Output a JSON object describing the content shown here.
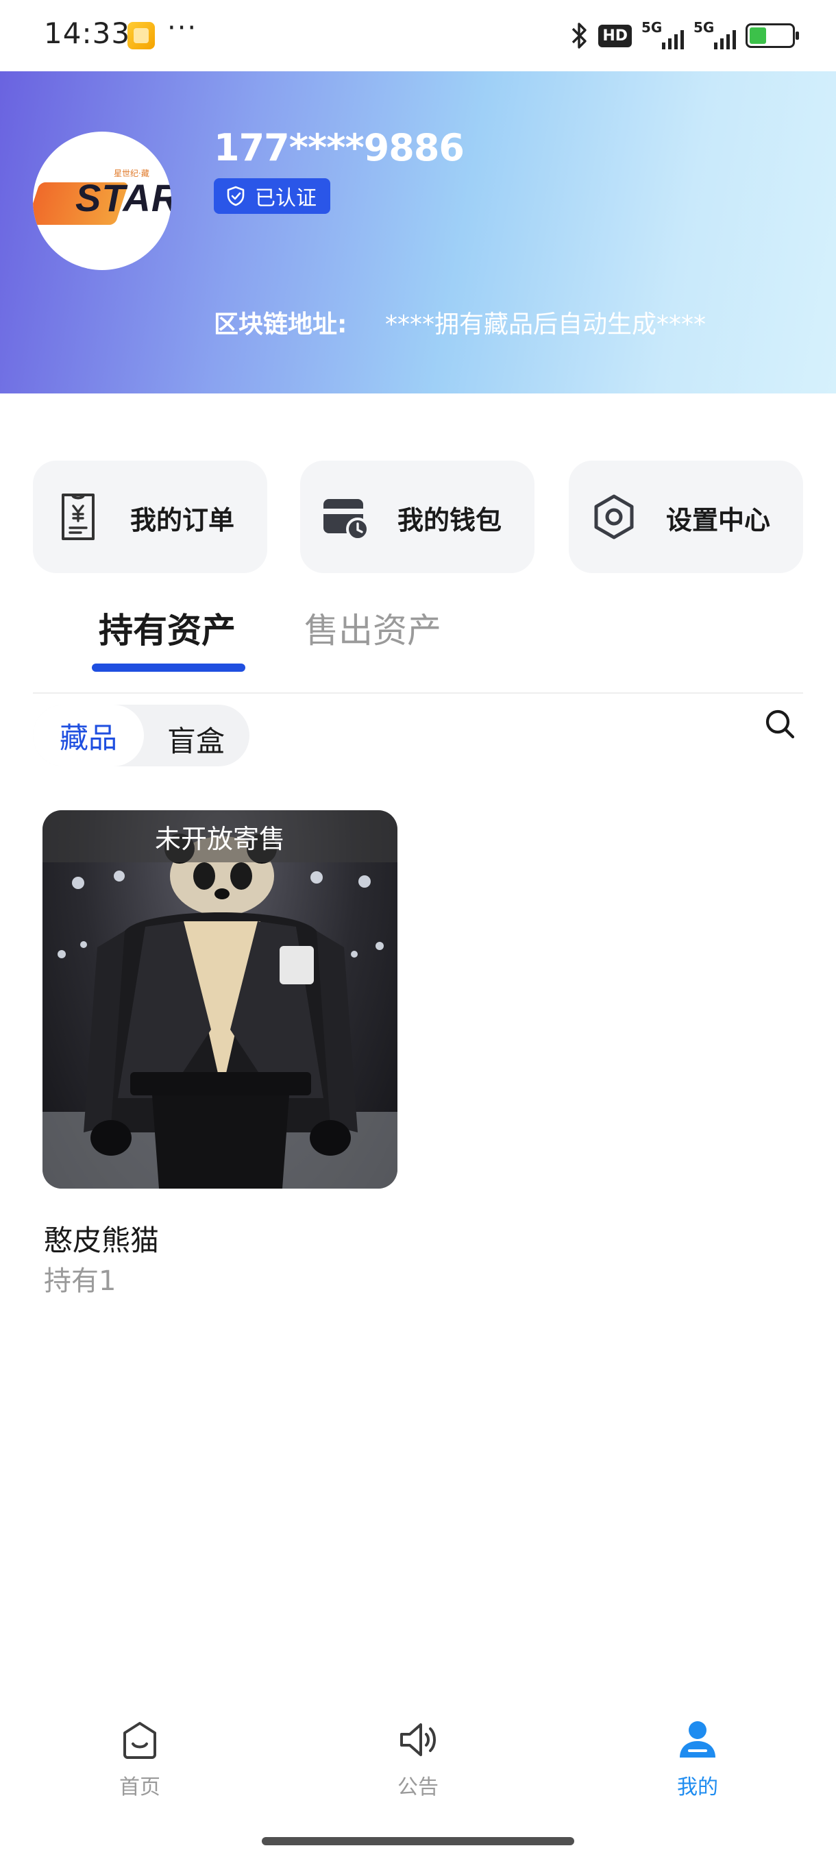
{
  "status_bar": {
    "time": "14:33",
    "more": "···",
    "hd_badge": "HD",
    "signal_1": "5G",
    "signal_2": "5G",
    "icons": [
      "app-icon",
      "bluetooth-icon",
      "hd-icon",
      "signal-icon",
      "signal-icon",
      "battery-icon"
    ]
  },
  "profile": {
    "avatar_text": "STAR",
    "avatar_subtext": "星世纪·藏",
    "phone": "177****9886",
    "verified_label": "已认证",
    "chain_label": "区块链地址:",
    "chain_value": "****拥有藏品后自动生成****"
  },
  "actions": [
    {
      "label": "我的订单",
      "icon": "receipt-icon"
    },
    {
      "label": "我的钱包",
      "icon": "wallet-icon"
    },
    {
      "label": "设置中心",
      "icon": "settings-icon"
    }
  ],
  "tabs": {
    "active": "持有资产",
    "inactive": "售出资产"
  },
  "segment": {
    "active": "藏品",
    "other": "盲盒"
  },
  "collection": [
    {
      "banner": "未开放寄售",
      "name": "憨皮熊猫",
      "holding": "持有1",
      "image": "panda-in-leather-jacket"
    }
  ],
  "bottom_nav": [
    {
      "label": "首页",
      "icon": "home-icon",
      "active": false
    },
    {
      "label": "公告",
      "icon": "speaker-icon",
      "active": false
    },
    {
      "label": "我的",
      "icon": "user-icon",
      "active": true
    }
  ],
  "colors": {
    "accent": "#1f4fe0",
    "nav_active": "#1e8cf0",
    "inactive_text": "#9a9a9a"
  }
}
